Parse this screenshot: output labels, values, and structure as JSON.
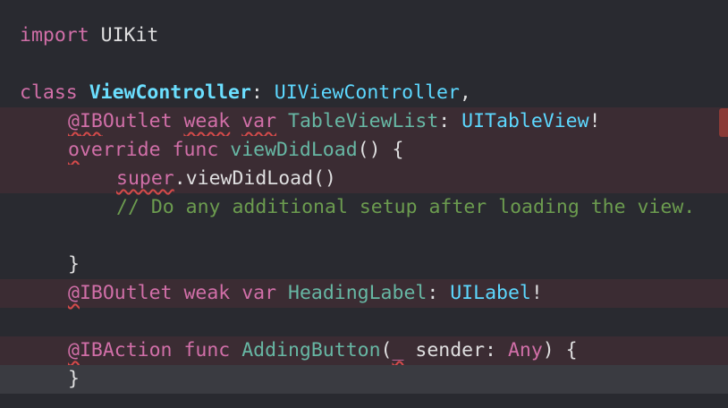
{
  "code_lines": [
    {
      "tokens": [
        "import",
        " ",
        "UIKit"
      ]
    },
    {
      "tokens": []
    },
    {
      "tokens": [
        "class",
        " ",
        "ViewController",
        ": ",
        "UIViewController",
        ","
      ]
    },
    {
      "tokens": [
        "@",
        "IB",
        "Outlet",
        " ",
        "weak",
        " ",
        "var",
        " ",
        "TableViewList",
        ": ",
        "UITableView",
        "!"
      ]
    },
    {
      "tokens": [
        "o",
        "verride",
        " ",
        "func",
        " ",
        "viewDidLoad",
        "() {"
      ]
    },
    {
      "tokens": [
        "super",
        ".",
        "viewDidLoad",
        "()"
      ]
    },
    {
      "tokens": [
        "// Do any additional setup after loading the view."
      ]
    },
    {
      "tokens": []
    },
    {
      "tokens": [
        "}"
      ]
    },
    {
      "tokens": [
        "@",
        "IBOutlet",
        " ",
        "weak",
        " ",
        "var",
        " ",
        "HeadingLabel",
        ": ",
        "UILabel",
        "!"
      ]
    },
    {
      "tokens": []
    },
    {
      "tokens": [
        "@",
        "IBAction",
        " ",
        "func",
        " ",
        "AddingButton",
        "(",
        "_",
        " sender: ",
        "Any",
        ") {"
      ]
    },
    {
      "tokens": [
        "}"
      ]
    }
  ],
  "colors": {
    "background": "#292a30",
    "keyword": "#d16fa8",
    "type_declaration": "#6bdfff",
    "system_type": "#5dd8ff",
    "function_declaration": "#67b7a4",
    "project_class": "#4eb0cc",
    "plain": "#dfdfe0",
    "comment": "#6c9c4f",
    "error_line_highlight": "#3b2c33",
    "current_line_highlight": "#3a3b41",
    "error_underline": "#d44a4a",
    "error_marker": "#8a3a36"
  }
}
